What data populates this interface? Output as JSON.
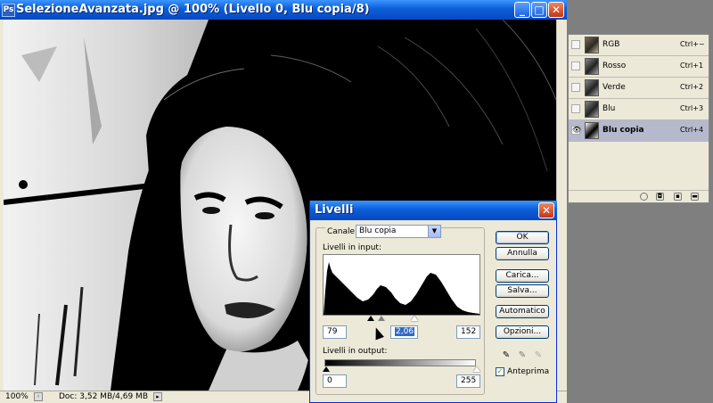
{
  "document": {
    "title": "SelezioneAvanzata.jpg @ 100% (Livello 0, Blu copia/8)",
    "zoom": "100%",
    "doc_info": "Doc: 3,52 MB/4,69 MB"
  },
  "channels": [
    {
      "name": "RGB",
      "shortcut": "Ctrl+~",
      "visible": false,
      "selected": false
    },
    {
      "name": "Rosso",
      "shortcut": "Ctrl+1",
      "visible": false,
      "selected": false
    },
    {
      "name": "Verde",
      "shortcut": "Ctrl+2",
      "visible": false,
      "selected": false
    },
    {
      "name": "Blu",
      "shortcut": "Ctrl+3",
      "visible": false,
      "selected": false
    },
    {
      "name": "Blu copia",
      "shortcut": "Ctrl+4",
      "visible": true,
      "selected": true
    }
  ],
  "levels_dialog": {
    "title": "Livelli",
    "channel_label": "Canale:",
    "channel_value": "Blu copia",
    "input_label": "Livelli in input:",
    "input_black": "79",
    "input_gamma": "2,06",
    "input_white": "152",
    "output_label": "Livelli in output:",
    "output_black": "0",
    "output_white": "255",
    "buttons": {
      "ok": "OK",
      "cancel": "Annulla",
      "load": "Carica...",
      "save": "Salva...",
      "auto": "Automatico",
      "options": "Opzioni..."
    },
    "preview_label": "Anteprima",
    "preview_checked": true
  },
  "colors": {
    "titlebar": "#0a5fd8",
    "selected_channel": "#b6b9cc",
    "dialog_bg": "#ece9d8"
  }
}
